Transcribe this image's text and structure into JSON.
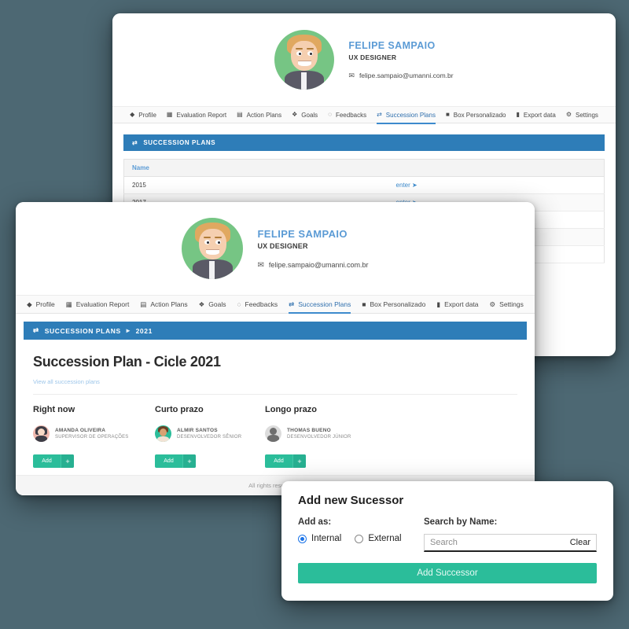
{
  "profile": {
    "name": "FELIPE SAMPAIO",
    "role": "UX DESIGNER",
    "email": "felipe.sampaio@umanni.com.br",
    "mail_icon": "envelope-icon",
    "avatar_name": "user-avatar-illustration"
  },
  "nav": {
    "items": [
      {
        "label": "Profile",
        "icon": "user-icon",
        "glyph": "◆",
        "active": false
      },
      {
        "label": "Evaluation Report",
        "icon": "grid-icon",
        "glyph": "▦",
        "active": false
      },
      {
        "label": "Action Plans",
        "icon": "list-icon",
        "glyph": "▤",
        "active": false
      },
      {
        "label": "Goals",
        "icon": "target-icon",
        "glyph": "❖",
        "active": false
      },
      {
        "label": "Feedbacks",
        "icon": "comment-icon",
        "glyph": "◌",
        "active": false
      },
      {
        "label": "Succession Plans",
        "icon": "exchange-icon",
        "glyph": "⇄",
        "active": true
      },
      {
        "label": "Box Personalizado",
        "icon": "grid-small-icon",
        "glyph": "■",
        "active": false
      },
      {
        "label": "Export data",
        "icon": "file-icon",
        "glyph": "▮",
        "active": false
      },
      {
        "label": "Settings",
        "icon": "gear-icon",
        "glyph": "⚙",
        "active": false
      }
    ]
  },
  "back_window": {
    "bar": {
      "icon": "exchange-icon",
      "title": "SUCCESSION PLANS"
    },
    "table": {
      "columns": [
        "Name",
        ""
      ],
      "rows": [
        {
          "name": "2015",
          "action": "enter",
          "action_arrow": "➜"
        },
        {
          "name": "2017",
          "action": "enter",
          "action_arrow": "➜"
        },
        {
          "name": "",
          "action": "",
          "action_arrow": ""
        },
        {
          "name": "",
          "action": "",
          "action_arrow": ""
        },
        {
          "name": "",
          "action": "",
          "action_arrow": ""
        }
      ]
    }
  },
  "front_window": {
    "breadcrumb": {
      "icon": "exchange-icon",
      "root": "SUCCESSION PLANS",
      "separator": "▸",
      "current": "2021"
    },
    "page_title": "Succession Plan - Cicle 2021",
    "view_all_link": "View all succession plans",
    "columns": [
      {
        "title": "Right now",
        "person": {
          "name": "AMANDA OLIVEIRA",
          "role": "SUPERVISOR DE OPERAÇÕES",
          "avatar_name": "avatar-amanda-oliveira",
          "avatar_color": "#f0b8ae"
        },
        "add_label": "Add",
        "add_plus": "+"
      },
      {
        "title": "Curto prazo",
        "person": {
          "name": "ALMIR SANTOS",
          "role": "DESENVOLVEDOR SÊNIOR",
          "avatar_name": "avatar-almir-santos",
          "avatar_color": "#2bbd9a"
        },
        "add_label": "Add",
        "add_plus": "+"
      },
      {
        "title": "Longo prazo",
        "person": {
          "name": "THOMAS BUENO",
          "role": "DESENVOLVEDOR JÚNIOR",
          "avatar_name": "avatar-thomas-bueno",
          "avatar_color": "#dcdcdc"
        },
        "add_label": "Add",
        "add_plus": "+"
      }
    ],
    "footer": "All rights reserved ©"
  },
  "modal": {
    "title": "Add new Sucessor",
    "add_as_label": "Add as:",
    "options": [
      {
        "label": "Internal",
        "selected": true
      },
      {
        "label": "External",
        "selected": false
      }
    ],
    "search_label": "Search by Name:",
    "search_value": "",
    "search_placeholder": "Search",
    "clear_label": "Clear",
    "submit_label": "Add Successor"
  },
  "colors": {
    "background": "#4d6873",
    "accent_blue": "#2e7db8",
    "accent_teal": "#2bbd9a",
    "link_blue": "#3d8bcd",
    "name_blue": "#5b9bd5"
  }
}
